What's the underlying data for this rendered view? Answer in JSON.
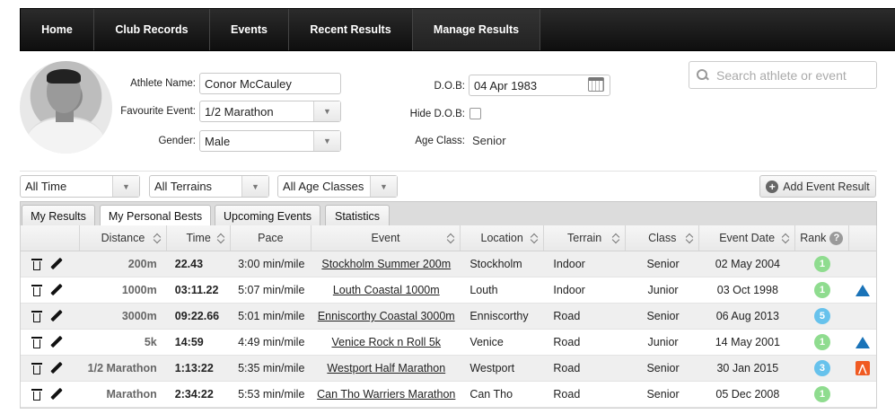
{
  "nav": {
    "items": [
      {
        "label": "Home"
      },
      {
        "label": "Club Records"
      },
      {
        "label": "Events"
      },
      {
        "label": "Recent Results"
      },
      {
        "label": "Manage Results"
      }
    ]
  },
  "profile": {
    "athlete_name_label": "Athlete Name:",
    "athlete_name": "Conor McCauley",
    "favourite_event_label": "Favourite Event:",
    "favourite_event": "1/2 Marathon",
    "gender_label": "Gender:",
    "gender": "Male",
    "dob_label": "D.O.B:",
    "dob": "04 Apr 1983",
    "hide_dob_label": "Hide D.O.B:",
    "hide_dob_checked": false,
    "age_class_label": "Age Class:",
    "age_class": "Senior"
  },
  "search": {
    "placeholder": "Search athlete or event"
  },
  "filters": {
    "time": "All Time",
    "terrain": "All Terrains",
    "age_class": "All Age Classes"
  },
  "add_button": {
    "label": "Add Event Result"
  },
  "tabs": [
    {
      "label": "My Results"
    },
    {
      "label": "My Personal Bests"
    },
    {
      "label": "Upcoming Events"
    },
    {
      "label": "Statistics"
    }
  ],
  "table": {
    "headers": {
      "distance": "Distance",
      "time": "Time",
      "pace": "Pace",
      "event": "Event",
      "location": "Location",
      "terrain": "Terrain",
      "class": "Class",
      "event_date": "Event Date",
      "rank": "Rank"
    },
    "rows": [
      {
        "distance": "200m",
        "time": "22.43",
        "pace": "3:00 min/mile",
        "event": "Stockholm Summer 200m",
        "location": "Stockholm",
        "terrain": "Indoor",
        "class": "Senior",
        "date": "02 May 2004",
        "rank": "1",
        "source": ""
      },
      {
        "distance": "1000m",
        "time": "03:11.22",
        "pace": "5:07 min/mile",
        "event": "Louth Coastal 1000m",
        "location": "Louth",
        "terrain": "Indoor",
        "class": "Junior",
        "date": "03 Oct 1998",
        "rank": "1",
        "source": "triangle"
      },
      {
        "distance": "3000m",
        "time": "09:22.66",
        "pace": "5:01 min/mile",
        "event": "Enniscorthy Coastal 3000m",
        "location": "Enniscorthy",
        "terrain": "Road",
        "class": "Senior",
        "date": "06 Aug 2013",
        "rank": "5",
        "source": ""
      },
      {
        "distance": "5k",
        "time": "14:59",
        "pace": "4:49 min/mile",
        "event": "Venice Rock n Roll 5k",
        "location": "Venice",
        "terrain": "Road",
        "class": "Junior",
        "date": "14 May 2001",
        "rank": "1",
        "source": "triangle"
      },
      {
        "distance": "1/2 Marathon",
        "time": "1:13:22",
        "pace": "5:35 min/mile",
        "event": "Westport Half Marathon",
        "location": "Westport",
        "terrain": "Road",
        "class": "Senior",
        "date": "30 Jan 2015",
        "rank": "3",
        "source": "strava"
      },
      {
        "distance": "Marathon",
        "time": "2:34:22",
        "pace": "5:53 min/mile",
        "event": "Can Tho Warriers Marathon",
        "location": "Can Tho",
        "terrain": "Road",
        "class": "Senior",
        "date": "05 Dec 2008",
        "rank": "1",
        "source": ""
      }
    ]
  },
  "colors": {
    "rank_1": "#8fdc8f",
    "rank_other": "#67c2ec",
    "strava": "#f05a22",
    "triangle": "#1a73b8"
  }
}
